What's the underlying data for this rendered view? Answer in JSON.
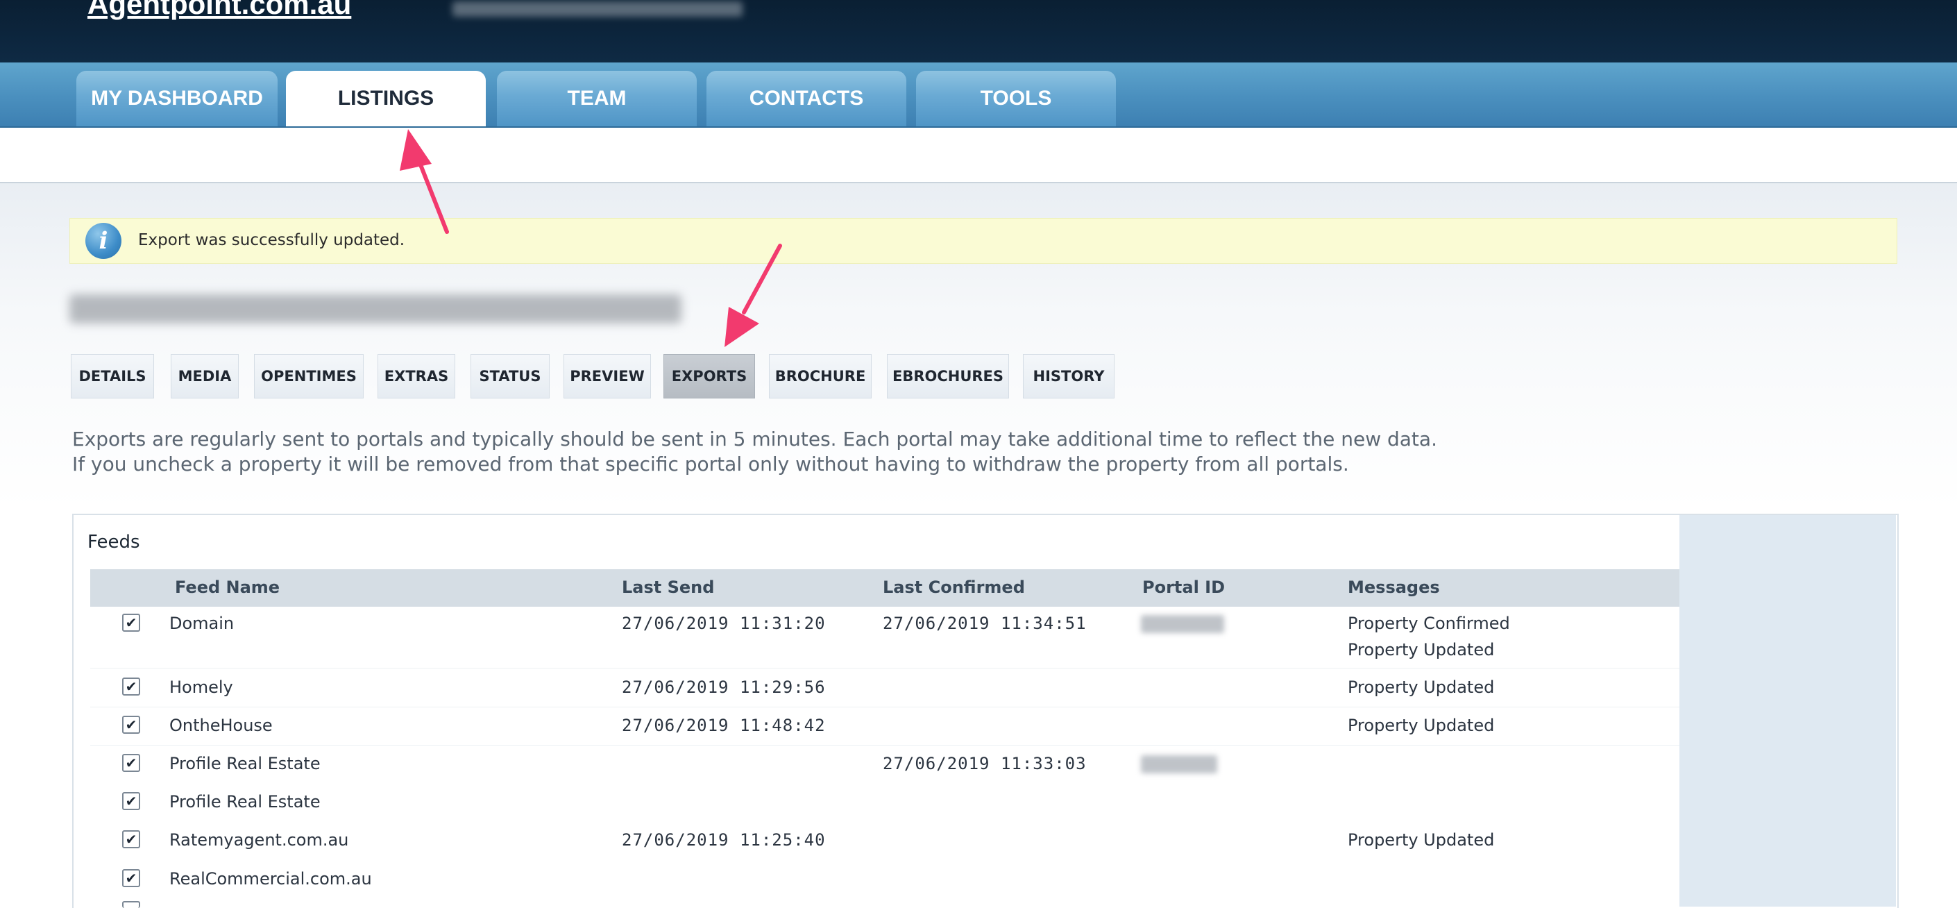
{
  "app": {
    "brand": "Agentpoint.com.au"
  },
  "nav": {
    "tabs": [
      {
        "label": "MY DASHBOARD"
      },
      {
        "label": "LISTINGS"
      },
      {
        "label": "TEAM"
      },
      {
        "label": "CONTACTS"
      },
      {
        "label": "TOOLS"
      }
    ]
  },
  "alert": {
    "message": "Export was successfully updated."
  },
  "listing_tabs": [
    {
      "label": "DETAILS"
    },
    {
      "label": "MEDIA"
    },
    {
      "label": "OPENTIMES"
    },
    {
      "label": "EXTRAS"
    },
    {
      "label": "STATUS"
    },
    {
      "label": "PREVIEW"
    },
    {
      "label": "EXPORTS"
    },
    {
      "label": "BROCHURE"
    },
    {
      "label": "EBROCHURES"
    },
    {
      "label": "HISTORY"
    }
  ],
  "description": {
    "line1": "Exports are regularly sent to portals and typically should be sent in 5 minutes. Each portal may take additional time to reflect the new data.",
    "line2": "If you uncheck a property it will be removed from that specific portal only without having to withdraw the property from all portals."
  },
  "feeds": {
    "title": "Feeds",
    "columns": [
      "Feed Name",
      "Last Send",
      "Last Confirmed",
      "Portal ID",
      "Messages"
    ],
    "rows": [
      {
        "checked": "✔",
        "name": "Domain",
        "last_send": "27/06/2019 11:31:20",
        "last_confirmed": "27/06/2019 11:34:51",
        "messages": [
          "Property Confirmed",
          "Property Updated"
        ]
      },
      {
        "checked": "✔",
        "name": "Homely",
        "last_send": "27/06/2019 11:29:56",
        "last_confirmed": "",
        "messages": [
          "Property Updated"
        ]
      },
      {
        "checked": "✔",
        "name": "OntheHouse",
        "last_send": "27/06/2019 11:48:42",
        "last_confirmed": "",
        "messages": [
          "Property Updated"
        ]
      },
      {
        "checked": "✔",
        "name": "Profile Real Estate",
        "last_send": "",
        "last_confirmed": "27/06/2019 11:33:03",
        "messages": []
      },
      {
        "checked": "✔",
        "name": "Profile Real Estate",
        "last_send": "",
        "last_confirmed": "",
        "messages": []
      },
      {
        "checked": "✔",
        "name": "Ratemyagent.com.au",
        "last_send": "27/06/2019 11:25:40",
        "last_confirmed": "",
        "messages": [
          "Property Updated"
        ]
      },
      {
        "checked": "✔",
        "name": "RealCommercial.com.au",
        "last_send": "",
        "last_confirmed": "",
        "messages": []
      }
    ]
  },
  "colors": {
    "header_bg": "#0e2a44",
    "nav_blue": "#4a8fbe",
    "alert_bg": "#fafbd4",
    "annotation_arrow": "#f23a6e"
  }
}
